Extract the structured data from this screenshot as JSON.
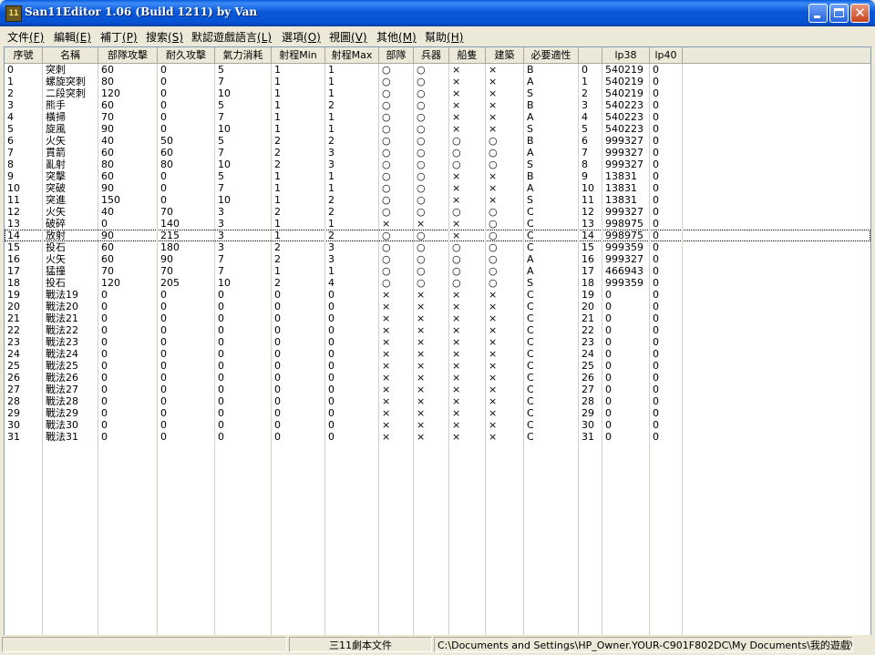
{
  "window": {
    "title": "San11Editor 1.06 (Build 1211) by Van",
    "icon_text": "11"
  },
  "menu": [
    {
      "label": "文件",
      "key": "(F)"
    },
    {
      "label": "編輯",
      "key": "(E)"
    },
    {
      "label": "補丁",
      "key": "(P)"
    },
    {
      "label": "搜索",
      "key": "(S)"
    },
    {
      "label": "默認遊戲語言",
      "key": "(L)"
    },
    {
      "label": "選項",
      "key": "(O)"
    },
    {
      "label": "視圖",
      "key": "(V)"
    },
    {
      "label": "其他",
      "key": "(M)"
    },
    {
      "label": "幫助",
      "key": "(H)"
    }
  ],
  "columns": [
    "序號",
    "名稱",
    "部隊攻擊",
    "耐久攻擊",
    "氣力消耗",
    "射程Min",
    "射程Max",
    "部隊",
    "兵器",
    "船隻",
    "建築",
    "必要適性",
    "",
    "lp38",
    "lp40"
  ],
  "rows": [
    [
      "0",
      "突刺",
      "60",
      "0",
      "5",
      "1",
      "1",
      "○",
      "○",
      "×",
      "×",
      "B",
      "0",
      "540219",
      "0"
    ],
    [
      "1",
      "螺旋突刺",
      "80",
      "0",
      "7",
      "1",
      "1",
      "○",
      "○",
      "×",
      "×",
      "A",
      "1",
      "540219",
      "0"
    ],
    [
      "2",
      "二段突刺",
      "120",
      "0",
      "10",
      "1",
      "1",
      "○",
      "○",
      "×",
      "×",
      "S",
      "2",
      "540219",
      "0"
    ],
    [
      "3",
      "熊手",
      "60",
      "0",
      "5",
      "1",
      "2",
      "○",
      "○",
      "×",
      "×",
      "B",
      "3",
      "540223",
      "0"
    ],
    [
      "4",
      "橫掃",
      "70",
      "0",
      "7",
      "1",
      "1",
      "○",
      "○",
      "×",
      "×",
      "A",
      "4",
      "540223",
      "0"
    ],
    [
      "5",
      "旋風",
      "90",
      "0",
      "10",
      "1",
      "1",
      "○",
      "○",
      "×",
      "×",
      "S",
      "5",
      "540223",
      "0"
    ],
    [
      "6",
      "火矢",
      "40",
      "50",
      "5",
      "2",
      "2",
      "○",
      "○",
      "○",
      "○",
      "B",
      "6",
      "999327",
      "0"
    ],
    [
      "7",
      "貫箭",
      "60",
      "60",
      "7",
      "2",
      "3",
      "○",
      "○",
      "○",
      "○",
      "A",
      "7",
      "999327",
      "0"
    ],
    [
      "8",
      "亂射",
      "80",
      "80",
      "10",
      "2",
      "3",
      "○",
      "○",
      "○",
      "○",
      "S",
      "8",
      "999327",
      "0"
    ],
    [
      "9",
      "突擊",
      "60",
      "0",
      "5",
      "1",
      "1",
      "○",
      "○",
      "×",
      "×",
      "B",
      "9",
      "13831",
      "0"
    ],
    [
      "10",
      "突破",
      "90",
      "0",
      "7",
      "1",
      "1",
      "○",
      "○",
      "×",
      "×",
      "A",
      "10",
      "13831",
      "0"
    ],
    [
      "11",
      "突進",
      "150",
      "0",
      "10",
      "1",
      "2",
      "○",
      "○",
      "×",
      "×",
      "S",
      "11",
      "13831",
      "0"
    ],
    [
      "12",
      "火矢",
      "40",
      "70",
      "3",
      "2",
      "2",
      "○",
      "○",
      "○",
      "○",
      "C",
      "12",
      "999327",
      "0"
    ],
    [
      "13",
      "破碎",
      "0",
      "140",
      "3",
      "1",
      "1",
      "×",
      "×",
      "×",
      "○",
      "C",
      "13",
      "998975",
      "0"
    ],
    [
      "14",
      "放射",
      "90",
      "215",
      "3",
      "1",
      "2",
      "○",
      "○",
      "×",
      "○",
      "C",
      "14",
      "998975",
      "0"
    ],
    [
      "15",
      "投石",
      "60",
      "180",
      "3",
      "2",
      "3",
      "○",
      "○",
      "○",
      "○",
      "C",
      "15",
      "999359",
      "0"
    ],
    [
      "16",
      "火矢",
      "60",
      "90",
      "7",
      "2",
      "3",
      "○",
      "○",
      "○",
      "○",
      "A",
      "16",
      "999327",
      "0"
    ],
    [
      "17",
      "猛撞",
      "70",
      "70",
      "7",
      "1",
      "1",
      "○",
      "○",
      "○",
      "○",
      "A",
      "17",
      "466943",
      "0"
    ],
    [
      "18",
      "投石",
      "120",
      "205",
      "10",
      "2",
      "4",
      "○",
      "○",
      "○",
      "○",
      "S",
      "18",
      "999359",
      "0"
    ],
    [
      "19",
      "戰法19",
      "0",
      "0",
      "0",
      "0",
      "0",
      "×",
      "×",
      "×",
      "×",
      "C",
      "19",
      "0",
      "0"
    ],
    [
      "20",
      "戰法20",
      "0",
      "0",
      "0",
      "0",
      "0",
      "×",
      "×",
      "×",
      "×",
      "C",
      "20",
      "0",
      "0"
    ],
    [
      "21",
      "戰法21",
      "0",
      "0",
      "0",
      "0",
      "0",
      "×",
      "×",
      "×",
      "×",
      "C",
      "21",
      "0",
      "0"
    ],
    [
      "22",
      "戰法22",
      "0",
      "0",
      "0",
      "0",
      "0",
      "×",
      "×",
      "×",
      "×",
      "C",
      "22",
      "0",
      "0"
    ],
    [
      "23",
      "戰法23",
      "0",
      "0",
      "0",
      "0",
      "0",
      "×",
      "×",
      "×",
      "×",
      "C",
      "23",
      "0",
      "0"
    ],
    [
      "24",
      "戰法24",
      "0",
      "0",
      "0",
      "0",
      "0",
      "×",
      "×",
      "×",
      "×",
      "C",
      "24",
      "0",
      "0"
    ],
    [
      "25",
      "戰法25",
      "0",
      "0",
      "0",
      "0",
      "0",
      "×",
      "×",
      "×",
      "×",
      "C",
      "25",
      "0",
      "0"
    ],
    [
      "26",
      "戰法26",
      "0",
      "0",
      "0",
      "0",
      "0",
      "×",
      "×",
      "×",
      "×",
      "C",
      "26",
      "0",
      "0"
    ],
    [
      "27",
      "戰法27",
      "0",
      "0",
      "0",
      "0",
      "0",
      "×",
      "×",
      "×",
      "×",
      "C",
      "27",
      "0",
      "0"
    ],
    [
      "28",
      "戰法28",
      "0",
      "0",
      "0",
      "0",
      "0",
      "×",
      "×",
      "×",
      "×",
      "C",
      "28",
      "0",
      "0"
    ],
    [
      "29",
      "戰法29",
      "0",
      "0",
      "0",
      "0",
      "0",
      "×",
      "×",
      "×",
      "×",
      "C",
      "29",
      "0",
      "0"
    ],
    [
      "30",
      "戰法30",
      "0",
      "0",
      "0",
      "0",
      "0",
      "×",
      "×",
      "×",
      "×",
      "C",
      "30",
      "0",
      "0"
    ],
    [
      "31",
      "戰法31",
      "0",
      "0",
      "0",
      "0",
      "0",
      "×",
      "×",
      "×",
      "×",
      "C",
      "31",
      "0",
      "0"
    ]
  ],
  "selected_row": 14,
  "status": {
    "file_type": "三11劇本文件",
    "path": "C:\\Documents and Settings\\HP_Owner.YOUR-C901F802DC\\My Documents\\我的遊戲\\三國志\\"
  }
}
